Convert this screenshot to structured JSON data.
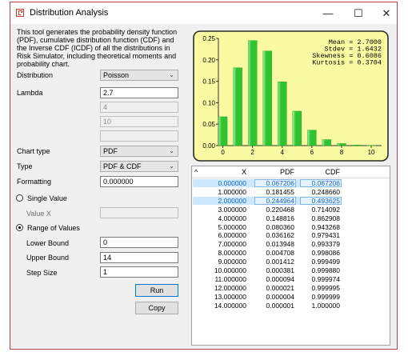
{
  "window": {
    "title": "Distribution Analysis",
    "minimize_glyph": "—",
    "maximize_glyph": "☐",
    "close_glyph": "✕"
  },
  "description": "This tool generates the probability density function (PDF), cumulative distribution function (CDF) and the Inverse CDF (ICDF) of all the distributions in Risk Simulator, including theoretical moments and probability chart.",
  "form": {
    "distribution_label": "Distribution",
    "distribution_value": "Poisson",
    "lambda_label": "Lambda",
    "lambda_value": "2.7",
    "param2_value": "4",
    "param3_value": "10",
    "param4_value": "",
    "chart_type_label": "Chart type",
    "chart_type_value": "PDF",
    "type_label": "Type",
    "type_value": "PDF & CDF",
    "formatting_label": "Formatting",
    "formatting_value": "0.000000",
    "single_value_label": "Single Value",
    "value_x_label": "Value X",
    "value_x_value": "",
    "range_label": "Range of Values",
    "lower_label": "Lower Bound",
    "lower_value": "0",
    "upper_label": "Upper Bound",
    "upper_value": "14",
    "step_label": "Step Size",
    "step_value": "1",
    "run_label": "Run",
    "copy_label": "Copy",
    "dropdown_glyph": "⌄"
  },
  "chart_data": {
    "type": "bar",
    "x": [
      0,
      1,
      2,
      3,
      4,
      5,
      6,
      7,
      8,
      9,
      10
    ],
    "values": [
      0.067206,
      0.181455,
      0.244964,
      0.220468,
      0.148816,
      0.08036,
      0.036162,
      0.013948,
      0.004708,
      0.001412,
      0.000381
    ],
    "xlim": [
      -0.3,
      10.7
    ],
    "ylim": [
      0,
      0.25
    ],
    "x_ticks": [
      "0",
      "2",
      "4",
      "6",
      "8",
      "10"
    ],
    "y_ticks": [
      "0.00",
      "0.05",
      "0.10",
      "0.15",
      "0.20",
      "0.25"
    ],
    "stats": [
      {
        "label": "Mean",
        "value": "2.7000"
      },
      {
        "label": "Stdev",
        "value": "1.6432"
      },
      {
        "label": "Skewness",
        "value": "0.6086"
      },
      {
        "label": "Kurtosis",
        "value": "0.3704"
      }
    ],
    "background": "#fafaa3",
    "bar_color": "#2fc42f",
    "bar_highlight": "#a4f0a4"
  },
  "table": {
    "sort_glyph": "^",
    "headers": [
      "X",
      "PDF",
      "CDF"
    ],
    "rows": [
      [
        "0.000000",
        "0.067206",
        "0.067206"
      ],
      [
        "1.000000",
        "0.181455",
        "0.248660"
      ],
      [
        "2.000000",
        "0.244964",
        "0.493625"
      ],
      [
        "3.000000",
        "0.220468",
        "0.714092"
      ],
      [
        "4.000000",
        "0.148816",
        "0.862908"
      ],
      [
        "5.000000",
        "0.080360",
        "0.943268"
      ],
      [
        "6.000000",
        "0.036162",
        "0.979431"
      ],
      [
        "7.000000",
        "0.013948",
        "0.993379"
      ],
      [
        "8.000000",
        "0.004708",
        "0.998086"
      ],
      [
        "9.000000",
        "0.001412",
        "0.999499"
      ],
      [
        "10.000000",
        "0.000381",
        "0.999880"
      ],
      [
        "11.000000",
        "0.000094",
        "0.999974"
      ],
      [
        "12.000000",
        "0.000021",
        "0.999995"
      ],
      [
        "13.000000",
        "0.000004",
        "0.999999"
      ],
      [
        "14.000000",
        "0.000001",
        "1.000000"
      ]
    ],
    "selected_rows": [
      0,
      2
    ]
  }
}
